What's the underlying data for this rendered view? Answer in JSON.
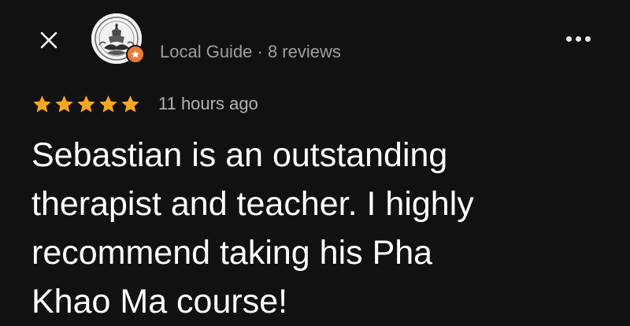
{
  "header": {
    "close_icon": "close-icon",
    "more_icon": "more-horizontal-icon",
    "reviewer": {
      "meta": "Local Guide · 8 reviews",
      "badge_icon": "local-guide-star-icon",
      "badge_color": "#ea7a36"
    }
  },
  "review": {
    "rating": 5,
    "rating_max": 5,
    "star_color": "#f5a623",
    "time": "11 hours ago",
    "text": "Sebastian is an outstanding\ntherapist and teacher. I highly\nrecommend taking his Pha\nKhao Ma course!"
  },
  "colors": {
    "background": "#111111",
    "primary_text": "#ffffff",
    "secondary_text": "#9e9e9e"
  }
}
